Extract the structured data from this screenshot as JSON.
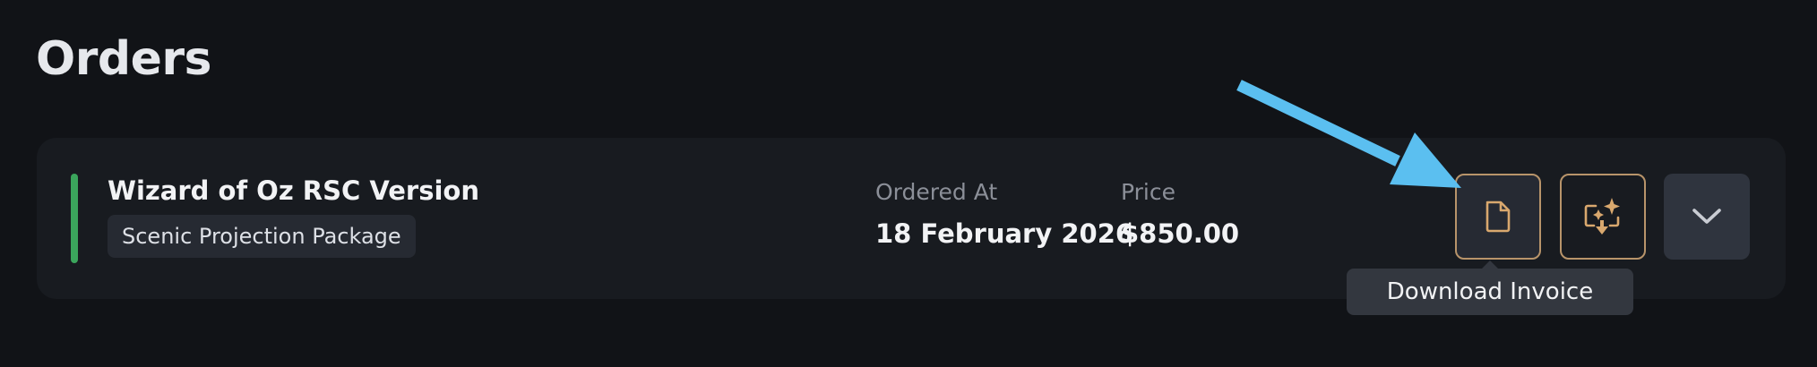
{
  "page": {
    "title": "Orders"
  },
  "order": {
    "name": "Wizard of Oz RSC Version",
    "package": "Scenic Projection Package",
    "status_color": "#3ba55c",
    "ordered_at_label": "Ordered At",
    "ordered_at_value": "18 February 2026",
    "price_label": "Price",
    "price_value": "$850.00"
  },
  "actions": {
    "invoice_icon": "document-icon",
    "ai_icon": "ai-transfer-icon",
    "expand_icon": "chevron-down-icon",
    "accent_color": "#b8946a"
  },
  "tooltip": {
    "text": "Download Invoice"
  },
  "annotation": {
    "arrow_color": "#5bbff0"
  }
}
